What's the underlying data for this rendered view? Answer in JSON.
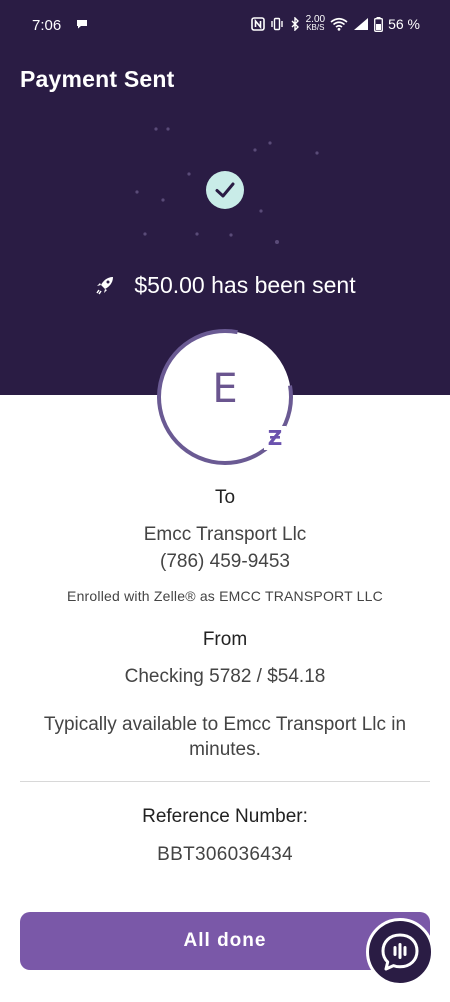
{
  "status_bar": {
    "time": "7:06",
    "net_speed_value": "2.00",
    "net_speed_unit": "KB/S",
    "battery": "56 %",
    "icons": [
      "chat-bubble-icon",
      "nfc-icon",
      "vibrate-icon",
      "bluetooth-icon",
      "wifi-icon",
      "signal-icon",
      "battery-icon"
    ]
  },
  "header": {
    "title": "Payment Sent"
  },
  "hero": {
    "sent_message": "$50.00 has been sent",
    "icons": [
      "check-icon",
      "rocket-icon"
    ]
  },
  "recipient": {
    "avatar_letter": "E",
    "badge": "Ƶ",
    "to_label": "To",
    "name": "Emcc Transport Llc",
    "phone": "(786) 459-9453",
    "enrolled": "Enrolled with Zelle® as EMCC TRANSPORT LLC"
  },
  "source": {
    "from_label": "From",
    "account": "Checking 5782 / $54.18"
  },
  "availability": "Typically available to Emcc Transport Llc in minutes.",
  "reference": {
    "label": "Reference Number:",
    "value": "BBT306036434"
  },
  "actions": {
    "done_label": "All done"
  },
  "colors": {
    "hero_bg": "#2a1c44",
    "accent": "#7a58a8",
    "check_bg": "#c9ece8"
  }
}
